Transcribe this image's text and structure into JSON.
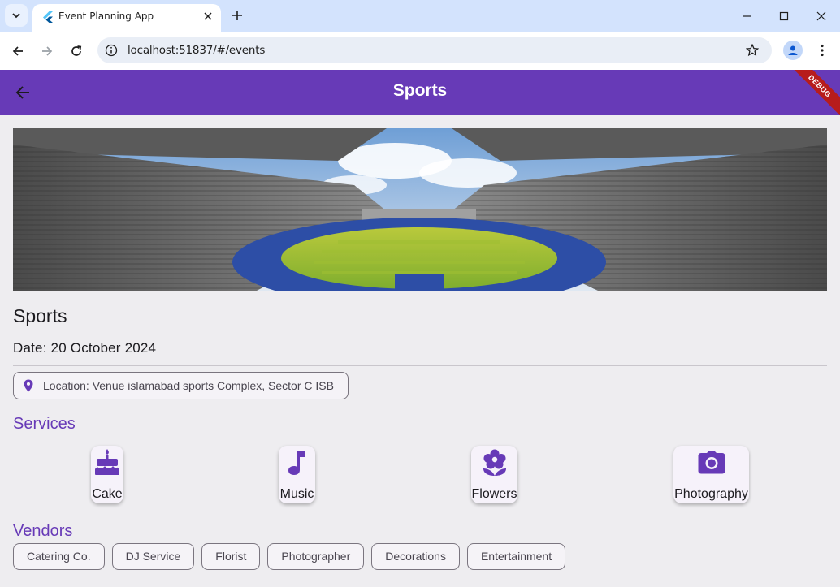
{
  "browser": {
    "tab_title": "Event Planning App",
    "url": "localhost:51837/#/events"
  },
  "app": {
    "title": "Sports",
    "debug_banner": "DEBUG",
    "colors": {
      "primary": "#673ab7",
      "background": "#eeedf0",
      "debug": "#b71c1c"
    }
  },
  "event": {
    "name": "Sports",
    "date": "Date: 20 October 2024",
    "location": "Location: Venue islamabad sports Complex, Sector C ISB"
  },
  "services": {
    "heading": "Services",
    "items": [
      {
        "label": "Cake",
        "icon": "cake-icon"
      },
      {
        "label": "Music",
        "icon": "music-note-icon"
      },
      {
        "label": "Flowers",
        "icon": "flower-icon"
      },
      {
        "label": "Photography",
        "icon": "camera-icon"
      }
    ]
  },
  "vendors": {
    "heading": "Vendors",
    "items": [
      "Catering Co.",
      "DJ Service",
      "Florist",
      "Photographer",
      "Decorations",
      "Entertainment"
    ]
  }
}
